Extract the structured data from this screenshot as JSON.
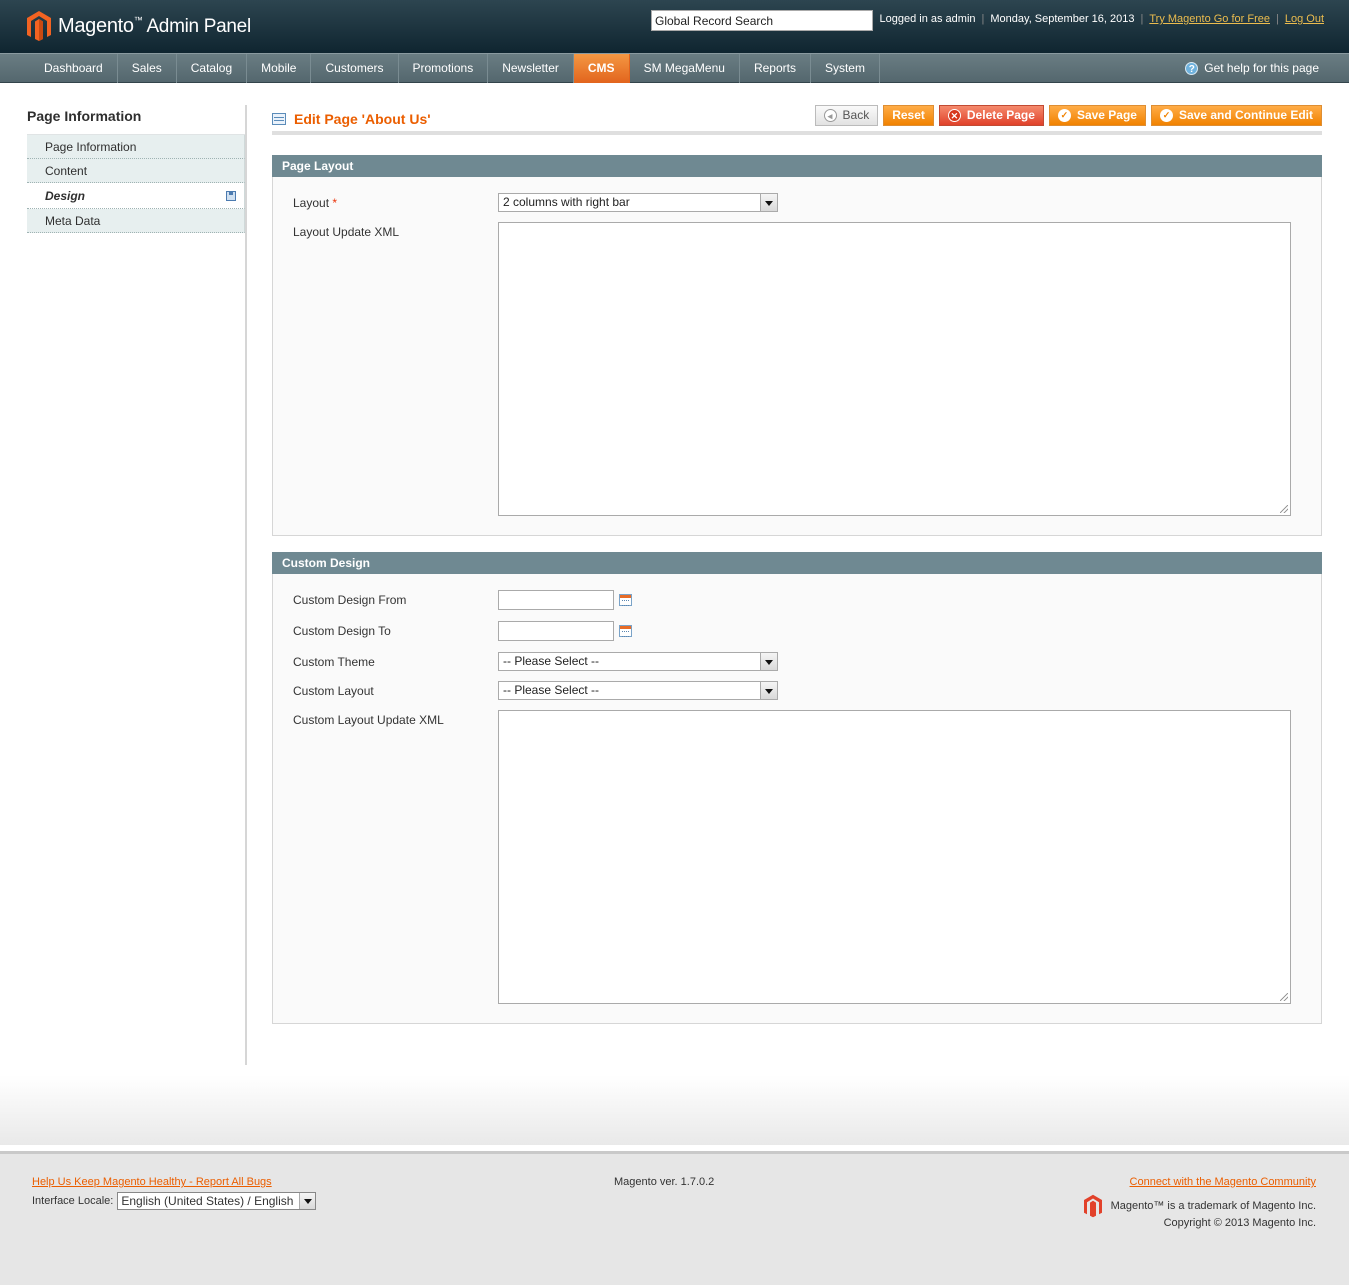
{
  "header": {
    "brand": "Magento",
    "brand_tm": "™",
    "brand_sub": "Admin Panel",
    "search_value": "Global Record Search",
    "logged_in": "Logged in as admin",
    "date": "Monday, September 16, 2013",
    "try_link": "Try Magento Go for Free",
    "logout": "Log Out",
    "separator": "|"
  },
  "nav": {
    "items": [
      "Dashboard",
      "Sales",
      "Catalog",
      "Mobile",
      "Customers",
      "Promotions",
      "Newsletter",
      "CMS",
      "SM MegaMenu",
      "Reports",
      "System"
    ],
    "active": "CMS",
    "help": "Get help for this page",
    "help_glyph": "?"
  },
  "sidebar": {
    "title": "Page Information",
    "tabs": [
      "Page Information",
      "Content",
      "Design",
      "Meta Data"
    ],
    "active_tab": "Design"
  },
  "content": {
    "title": "Edit Page 'About Us'",
    "buttons": {
      "back": "Back",
      "reset": "Reset",
      "delete": "Delete Page",
      "save": "Save Page",
      "save_continue": "Save and Continue Edit"
    },
    "page_layout": {
      "header": "Page Layout",
      "layout_label": "Layout",
      "required_mark": "*",
      "layout_value": "2 columns with right bar",
      "layout_xml_label": "Layout Update XML"
    },
    "custom_design": {
      "header": "Custom Design",
      "from_label": "Custom Design From",
      "to_label": "Custom Design To",
      "theme_label": "Custom Theme",
      "theme_value": "-- Please Select --",
      "layout_label": "Custom Layout",
      "layout_value": "-- Please Select --",
      "xml_label": "Custom Layout Update XML"
    }
  },
  "footer": {
    "bugs_link": "Help Us Keep Magento Healthy - Report All Bugs",
    "locale_label": "Interface Locale:",
    "locale_value": "English (United States) / English",
    "version": "Magento ver. 1.7.0.2",
    "community_link": "Connect with the Magento Community",
    "trademark": "Magento™ is a trademark of Magento Inc.",
    "copyright": "Copyright © 2013 Magento Inc."
  },
  "colors": {
    "accent": "#eb5e00",
    "nav_bg": "#5f727a",
    "fieldset_header": "#6f8992",
    "header_bg": "#1c333d"
  }
}
